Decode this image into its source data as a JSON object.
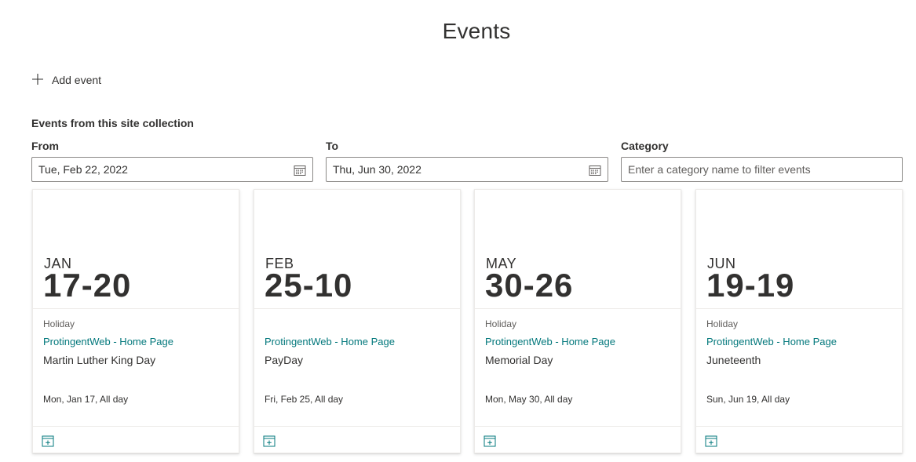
{
  "page": {
    "title": "Events"
  },
  "toolbar": {
    "add_event_label": "Add event"
  },
  "filters": {
    "section_label": "Events from this site collection",
    "from_label": "From",
    "from_value": "Tue, Feb 22, 2022",
    "to_label": "To",
    "to_value": "Thu, Jun 30, 2022",
    "category_label": "Category",
    "category_placeholder": "Enter a category name to filter events"
  },
  "events": [
    {
      "month": "JAN",
      "days": "17-20",
      "category": "Holiday",
      "site": "ProtingentWeb - Home Page",
      "title": "Martin Luther King Day",
      "date": "Mon, Jan 17, All day"
    },
    {
      "month": "FEB",
      "days": "25-10",
      "category": "",
      "site": "ProtingentWeb - Home Page",
      "title": "PayDay",
      "date": "Fri, Feb 25, All day"
    },
    {
      "month": "MAY",
      "days": "30-26",
      "category": "Holiday",
      "site": "ProtingentWeb - Home Page",
      "title": "Memorial Day",
      "date": "Mon, May 30, All day"
    },
    {
      "month": "JUN",
      "days": "19-19",
      "category": "Holiday",
      "site": "ProtingentWeb - Home Page",
      "title": "Juneteenth",
      "date": "Sun, Jun 19, All day"
    }
  ],
  "colors": {
    "accent": "#03787c",
    "text": "#323130",
    "muted": "#605e5c",
    "border": "#8a8886"
  },
  "icons": {
    "add": "plus-icon",
    "calendar": "calendar-icon",
    "add_to_calendar": "add-to-calendar-icon"
  }
}
